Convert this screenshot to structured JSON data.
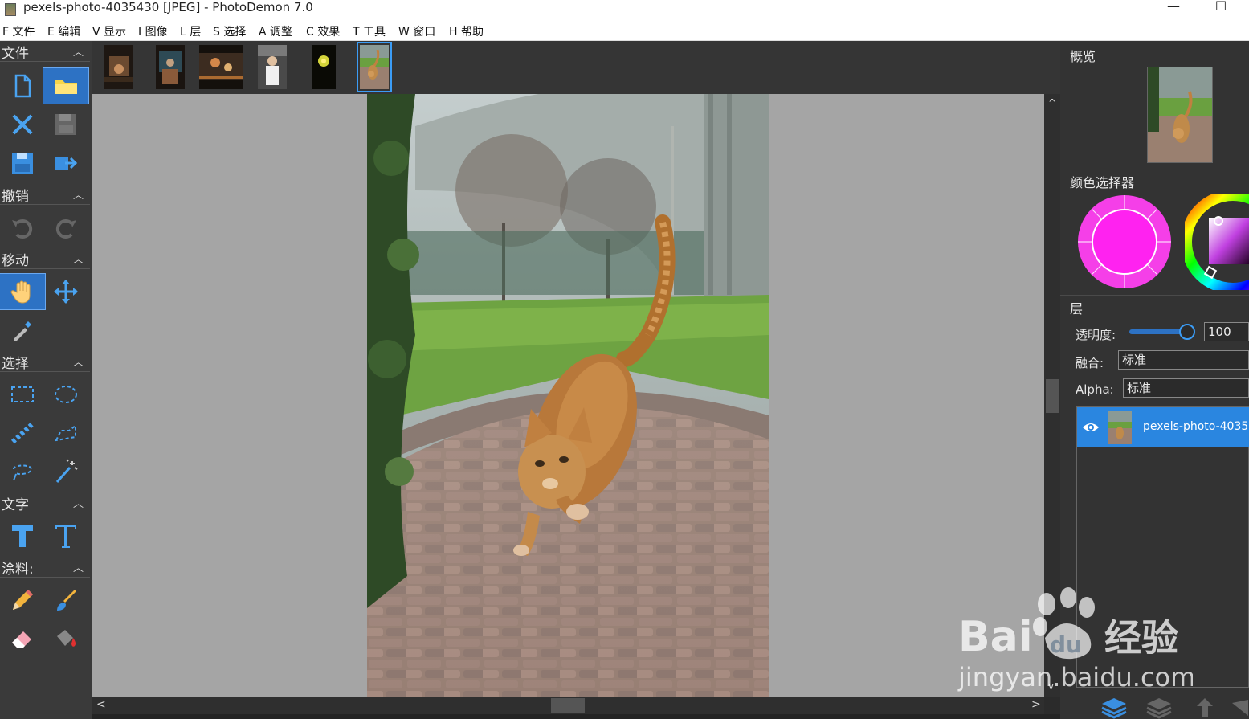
{
  "window": {
    "title": "pexels-photo-4035430 [JPEG]  -  PhotoDemon 7.0",
    "minimize_glyph": "—",
    "maximize_glyph": "☐"
  },
  "menu": [
    {
      "label": "F 文件"
    },
    {
      "label": "E 编辑"
    },
    {
      "label": "V 显示"
    },
    {
      "label": "I 图像"
    },
    {
      "label": "L 层"
    },
    {
      "label": "S 选择"
    },
    {
      "label": "A 调整"
    },
    {
      "label": "C 效果"
    },
    {
      "label": "T 工具"
    },
    {
      "label": "W 窗口"
    },
    {
      "label": "H 帮助"
    }
  ],
  "toolbar": {
    "sections": {
      "file": "文件",
      "undo": "撤销",
      "move": "移动",
      "select": "选择",
      "text": "文字",
      "paint": "涂料:"
    },
    "tools": [
      {
        "icon": "new-file-icon"
      },
      {
        "icon": "open-folder-icon",
        "active": true
      },
      {
        "icon": "close-icon"
      },
      {
        "icon": "save-icon"
      },
      {
        "icon": "save-as-icon"
      },
      {
        "icon": "export-icon"
      },
      {
        "icon": "undo-icon"
      },
      {
        "icon": "redo-icon"
      },
      {
        "icon": "hand-icon",
        "active": true
      },
      {
        "icon": "move-arrows-icon"
      },
      {
        "icon": "eyedropper-icon"
      },
      {
        "icon": "rect-select-icon"
      },
      {
        "icon": "ellipse-select-icon"
      },
      {
        "icon": "line-select-icon"
      },
      {
        "icon": "polygon-select-icon"
      },
      {
        "icon": "lasso-select-icon"
      },
      {
        "icon": "magic-wand-icon"
      },
      {
        "icon": "text-bold-icon"
      },
      {
        "icon": "text-outline-icon"
      },
      {
        "icon": "pencil-icon"
      },
      {
        "icon": "brush-icon"
      },
      {
        "icon": "eraser-icon"
      },
      {
        "icon": "fill-bucket-icon"
      }
    ]
  },
  "right_panel": {
    "overview_title": "概览",
    "color_picker_title": "颜色选择器",
    "primary_color": "#ff22f0",
    "layers_title": "层",
    "opacity_label": "透明度:",
    "opacity_value": "100",
    "opacity_percent": 100,
    "blend_label": "融合:",
    "blend_value": "标准",
    "alpha_label": "Alpha:",
    "alpha_value": "标准",
    "layer_name": "pexels-photo-4035"
  },
  "watermark": {
    "brand": "Bai",
    "brand_du": "du",
    "brand_cn": "经验",
    "url": "jingyan.baidu.com"
  },
  "colors": {
    "accent": "#2d72c4",
    "selection": "#3b9cf5",
    "layer_selected": "#2a86e0"
  }
}
